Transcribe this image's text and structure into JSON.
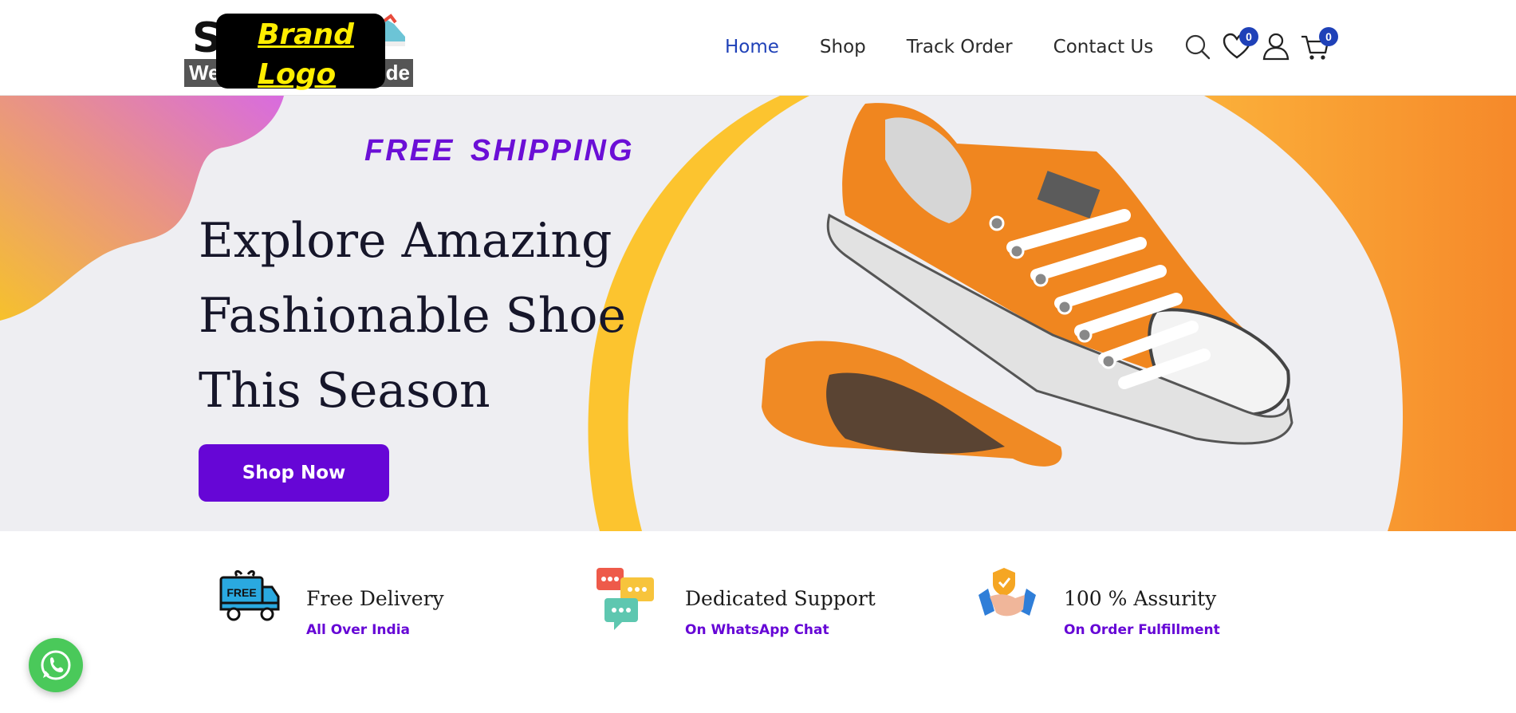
{
  "header": {
    "logo_partial_left": "We",
    "logo_partial_right": "ide",
    "logo_initial": "S",
    "brand_text": "Brand Logo",
    "nav": [
      {
        "label": "Home",
        "active": true
      },
      {
        "label": "Shop",
        "active": false
      },
      {
        "label": "Track Order",
        "active": false
      },
      {
        "label": "Contact Us",
        "active": false
      }
    ],
    "icons": [
      "search-icon",
      "heart-icon",
      "user-icon",
      "cart-icon"
    ],
    "wishlist_count": "0",
    "cart_count": "0"
  },
  "hero": {
    "tagline": "FREE SHIPPING",
    "title_line1": "Explore Amazing",
    "title_line2": "Fashionable Shoe",
    "title_line3": "This Season",
    "cta_label": "Shop Now"
  },
  "features": [
    {
      "icon": "delivery-truck-icon",
      "icon_text": "FREE",
      "title": "Free Delivery",
      "subtitle": "All Over India"
    },
    {
      "icon": "chat-bubbles-icon",
      "title": "Dedicated Support",
      "subtitle": "On WhatsApp Chat"
    },
    {
      "icon": "handshake-shield-icon",
      "title": "100 % Assurity",
      "subtitle": "On Order Fulfillment"
    }
  ],
  "floating": {
    "icon": "whatsapp-icon"
  },
  "colors": {
    "accent_purple": "#6606d6",
    "nav_active": "#1f41b8",
    "hero_orange": "#f7962e",
    "hero_yellow": "#fcc42f",
    "whatsapp_green": "#4ac95a"
  }
}
